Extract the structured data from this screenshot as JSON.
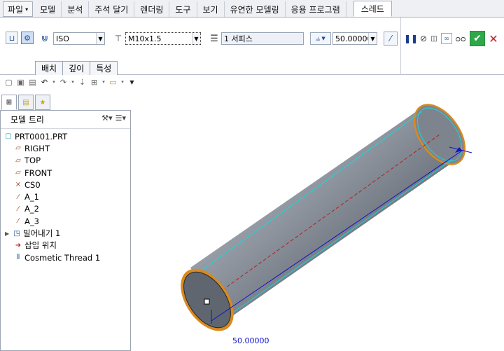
{
  "menubar": {
    "file_label": "파일",
    "tabs": [
      "모델",
      "분석",
      "주석 달기",
      "렌더링",
      "도구",
      "보기",
      "유연한 모델링",
      "응용 프로그램"
    ],
    "active_tab": "스레드"
  },
  "ribbon": {
    "standard_value": "ISO",
    "size_value": "M10x1.5",
    "thread_type_value": "1 서피스",
    "depth_value": "50.00000",
    "subtabs": [
      "배치",
      "깊이",
      "특성"
    ]
  },
  "model_tree": {
    "title": "모델 트리",
    "items": [
      {
        "label": "PRT0001.PRT",
        "icon": "part-icon"
      },
      {
        "label": "RIGHT",
        "icon": "datum-plane-icon"
      },
      {
        "label": "TOP",
        "icon": "datum-plane-icon"
      },
      {
        "label": "FRONT",
        "icon": "datum-plane-icon"
      },
      {
        "label": "CS0",
        "icon": "coordinate-system-icon"
      },
      {
        "label": "A_1",
        "icon": "datum-axis-icon"
      },
      {
        "label": "A_2",
        "icon": "datum-axis-icon"
      },
      {
        "label": "A_3",
        "icon": "datum-axis-icon"
      },
      {
        "label": "밀어내기 1",
        "icon": "extrude-icon"
      },
      {
        "label": "삽입 위치",
        "icon": "insert-here-icon"
      },
      {
        "label": "Cosmetic Thread 1",
        "icon": "cosmetic-thread-icon"
      }
    ]
  },
  "canvas": {
    "dimension_label": "50.00000"
  },
  "colors": {
    "accent": "#1a4f9c",
    "cylinder_body": "#8e949e",
    "thread_edge": "#d98a1e",
    "edge_cyan": "#19d6d6",
    "centerline": "#b02020",
    "dimension": "#1010c8"
  }
}
